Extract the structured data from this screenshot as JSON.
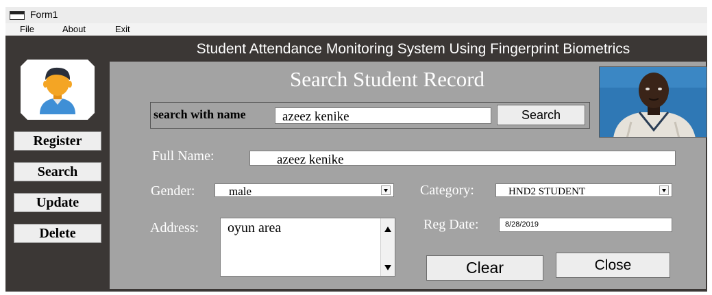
{
  "window": {
    "title": "Form1"
  },
  "menu": {
    "file": "File",
    "about": "About",
    "exit": "Exit"
  },
  "header": {
    "title": "Student Attendance Monitoring System Using Fingerprint Biometrics"
  },
  "sidebar": {
    "register": "Register",
    "search": "Search",
    "update": "Update",
    "delete": "Delete"
  },
  "form": {
    "title": "Search Student Record",
    "search_label": "search with name",
    "search_value": "azeez kenike",
    "search_button": "Search",
    "fullname_label": "Full Name:",
    "fullname_value": "azeez kenike",
    "gender_label": "Gender:",
    "gender_value": "male",
    "category_label": "Category:",
    "category_value": "HND2 STUDENT",
    "address_label": "Address:",
    "address_value": "oyun area",
    "regdate_label": "Reg Date:",
    "regdate_value": "8/28/2019",
    "clear_button": "Clear",
    "close_button": "Close"
  },
  "icons": {
    "avatar": "user-avatar-icon",
    "photo": "student-photo"
  },
  "colors": {
    "frame": "#3b3735",
    "panel": "#a3a3a3",
    "avatar_hair": "#2a2f3a",
    "avatar_skin": "#f4a524",
    "avatar_shirt": "#3f8fd6"
  }
}
